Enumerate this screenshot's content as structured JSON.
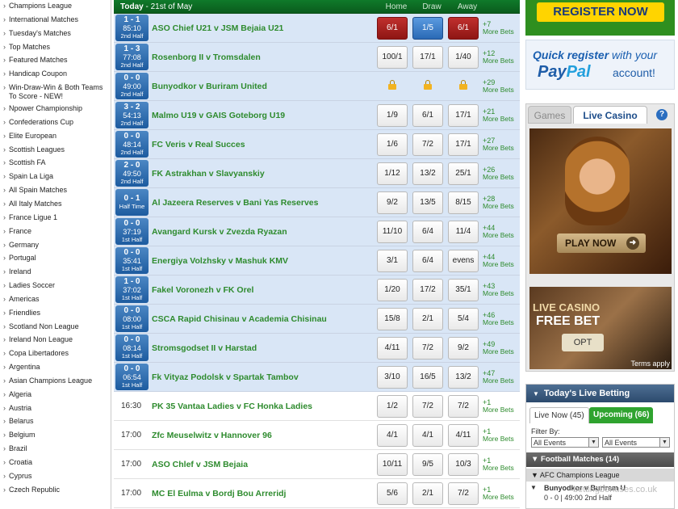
{
  "sidebar": {
    "items": [
      "Champions League",
      "International Matches",
      "Tuesday's Matches",
      "Top Matches",
      "Featured Matches",
      "Handicap Coupon",
      "Win-Draw-Win & Both Teams To Score - NEW!",
      "Npower Championship",
      "Confederations Cup",
      "Elite European",
      "Scottish Leagues",
      "Scottish FA",
      "Spain La Liga",
      "All Spain Matches",
      "All Italy Matches",
      "France Ligue 1",
      "France",
      "Germany",
      "Portugal",
      "Ireland",
      "Ladies Soccer",
      "Americas",
      "Friendlies",
      "Scotland Non League",
      "Ireland Non League",
      "Copa Libertadores",
      "Argentina",
      "Asian Champions League",
      "Algeria",
      "Austria",
      "Belarus",
      "Belgium",
      "Brazil",
      "Croatia",
      "Cyprus",
      "Czech Republic"
    ]
  },
  "header": {
    "today": "Today",
    "date": " - 21st of May",
    "home": "Home",
    "draw": "Draw",
    "away": "Away"
  },
  "matches": [
    {
      "score": "1 - 1",
      "time": "85:10",
      "half": "2nd Half",
      "name": "ASO Chief U21 v JSM Bejaia U21",
      "home": "6/1",
      "draw": "1/5",
      "away": "6/1",
      "more": "+7",
      "style": "flash"
    },
    {
      "score": "1 - 3",
      "time": "77:08",
      "half": "2nd Half",
      "name": "Rosenborg II v Tromsdalen",
      "home": "100/1",
      "draw": "17/1",
      "away": "1/40",
      "more": "+12"
    },
    {
      "score": "0 - 0",
      "time": "49:00",
      "half": "2nd Half",
      "name": "Bunyodkor v Buriram United",
      "home": "",
      "draw": "",
      "away": "",
      "more": "+29",
      "style": "locked"
    },
    {
      "score": "3 - 2",
      "time": "54:13",
      "half": "2nd Half",
      "name": "Malmo U19 v GAIS Goteborg U19",
      "home": "1/9",
      "draw": "6/1",
      "away": "17/1",
      "more": "+21"
    },
    {
      "score": "0 - 0",
      "time": "48:14",
      "half": "2nd Half",
      "name": "FC Veris v Real Succes",
      "home": "1/6",
      "draw": "7/2",
      "away": "17/1",
      "more": "+27"
    },
    {
      "score": "2 - 0",
      "time": "49:50",
      "half": "2nd Half",
      "name": "FK Astrakhan v Slavyanskiy",
      "home": "1/12",
      "draw": "13/2",
      "away": "25/1",
      "more": "+26"
    },
    {
      "score": "0 - 1",
      "time": "",
      "half": "Half Time",
      "name": "Al Jazeera Reserves v Bani Yas Reserves",
      "home": "9/2",
      "draw": "13/5",
      "away": "8/15",
      "more": "+28"
    },
    {
      "score": "0 - 0",
      "time": "37:19",
      "half": "1st Half",
      "name": "Avangard Kursk v Zvezda Ryazan",
      "home": "11/10",
      "draw": "6/4",
      "away": "11/4",
      "more": "+44"
    },
    {
      "score": "0 - 0",
      "time": "35:41",
      "half": "1st Half",
      "name": "Energiya Volzhsky v Mashuk KMV",
      "home": "3/1",
      "draw": "6/4",
      "away": "evens",
      "more": "+44"
    },
    {
      "score": "1 - 0",
      "time": "37:02",
      "half": "1st Half",
      "name": "Fakel Voronezh v FK Orel",
      "home": "1/20",
      "draw": "17/2",
      "away": "35/1",
      "more": "+43"
    },
    {
      "score": "0 - 0",
      "time": "08:00",
      "half": "1st Half",
      "name": "CSCA Rapid Chisinau v Academia Chisinau",
      "home": "15/8",
      "draw": "2/1",
      "away": "5/4",
      "more": "+46"
    },
    {
      "score": "0 - 0",
      "time": "08:14",
      "half": "1st Half",
      "name": "Stromsgodset II v Harstad",
      "home": "4/11",
      "draw": "7/2",
      "away": "9/2",
      "more": "+49"
    },
    {
      "score": "0 - 0",
      "time": "06:54",
      "half": "1st Half",
      "name": "Fk Vityaz Podolsk v Spartak Tambov",
      "home": "3/10",
      "draw": "16/5",
      "away": "13/2",
      "more": "+47"
    }
  ],
  "upcoming": [
    {
      "kickoff": "16:30",
      "name": "PK 35 Vantaa Ladies v FC Honka Ladies",
      "home": "1/2",
      "draw": "7/2",
      "away": "7/2",
      "more": "+1"
    },
    {
      "kickoff": "17:00",
      "name": "Zfc Meuselwitz v Hannover 96",
      "home": "4/1",
      "draw": "4/1",
      "away": "4/11",
      "more": "+1"
    },
    {
      "kickoff": "17:00",
      "name": "ASO Chlef v JSM Bejaia",
      "home": "10/11",
      "draw": "9/5",
      "away": "10/3",
      "more": "+1"
    },
    {
      "kickoff": "17:00",
      "name": "MC El Eulma v Bordj Bou Arreridj",
      "home": "5/6",
      "draw": "2/1",
      "away": "7/2",
      "more": "+1"
    }
  ],
  "more_bets_label": "More Bets",
  "right": {
    "register": "REGISTER NOW",
    "paypal_line1_a": "Quick register",
    "paypal_line1_b": " with your",
    "paypal_pay": "Pay",
    "paypal_pal": "Pal",
    "paypal_account": " account!",
    "tab_games": "Games",
    "tab_live_casino": "Live Casino",
    "help": "?",
    "play_now": "PLAY NOW",
    "promo_live_casino": "LIVE CASINO",
    "promo_free_bet": "FREE BET",
    "promo_opt": "OPT",
    "terms": "Terms apply",
    "live_betting_title": "Today's Live Betting",
    "tab_live_now": "Live Now (45)",
    "tab_upcoming": "Upcoming (66)",
    "filter_by": "Filter By:",
    "filter1": "All Events",
    "filter2": "All Events",
    "football_matches": "Football Matches (14)",
    "afc": "AFC Champions League",
    "afc_row_line1": "Bunyodkor v Buriram U",
    "afc_row_line2": "0 - 0 | 49:00 2nd Half"
  },
  "watermark": "bettingbonuses.co.uk"
}
